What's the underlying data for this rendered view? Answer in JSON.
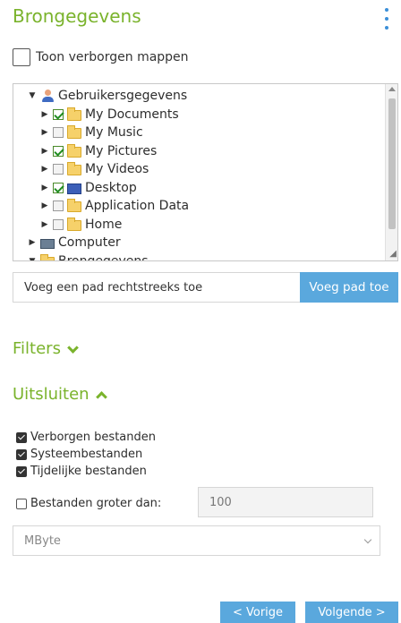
{
  "header": {
    "title": "Brongegevens",
    "menu_icon": "kebab-menu-icon"
  },
  "show_hidden": {
    "label": "Toon verborgen mappen",
    "checked": false
  },
  "tree": {
    "nodes": [
      {
        "label": "Gebruikersgegevens",
        "level": 0,
        "expanded": true,
        "icon": "user-icon",
        "checkbox": null
      },
      {
        "label": "My Documents",
        "level": 1,
        "expanded": false,
        "icon": "folder-icon",
        "checkbox": true
      },
      {
        "label": "My Music",
        "level": 1,
        "expanded": false,
        "icon": "music-folder-icon",
        "checkbox": false
      },
      {
        "label": "My Pictures",
        "level": 1,
        "expanded": false,
        "icon": "pictures-folder-icon",
        "checkbox": true
      },
      {
        "label": "My Videos",
        "level": 1,
        "expanded": false,
        "icon": "folder-icon",
        "checkbox": false
      },
      {
        "label": "Desktop",
        "level": 1,
        "expanded": false,
        "icon": "desktop-icon",
        "checkbox": true
      },
      {
        "label": "Application Data",
        "level": 1,
        "expanded": false,
        "icon": "folder-icon",
        "checkbox": false
      },
      {
        "label": "Home",
        "level": 1,
        "expanded": false,
        "icon": "home-folder-icon",
        "checkbox": false
      },
      {
        "label": "Computer",
        "level": 0,
        "expanded": false,
        "icon": "computer-icon",
        "checkbox": null
      },
      {
        "label": "Brongegevens",
        "level": 0,
        "expanded": true,
        "icon": "folder-icon",
        "checkbox": null
      }
    ]
  },
  "path": {
    "placeholder": "Voeg een pad rechtstreeks toe",
    "button_label": "Voeg pad toe"
  },
  "filters": {
    "label": "Filters",
    "expanded": false
  },
  "exclude": {
    "label": "Uitsluiten",
    "expanded": true,
    "options": [
      {
        "label": "Verborgen bestanden",
        "checked": true
      },
      {
        "label": "Systeembestanden",
        "checked": true
      },
      {
        "label": "Tijdelijke bestanden",
        "checked": true
      }
    ],
    "larger_than": {
      "label": "Bestanden groter dan:",
      "checked": false,
      "value": "100"
    },
    "unit": {
      "selected": "MByte"
    }
  },
  "nav": {
    "prev_label": "< Vorige",
    "next_label": "Volgende >"
  },
  "colors": {
    "accent_green": "#7ab32c",
    "button_blue": "#5aa8dd"
  }
}
